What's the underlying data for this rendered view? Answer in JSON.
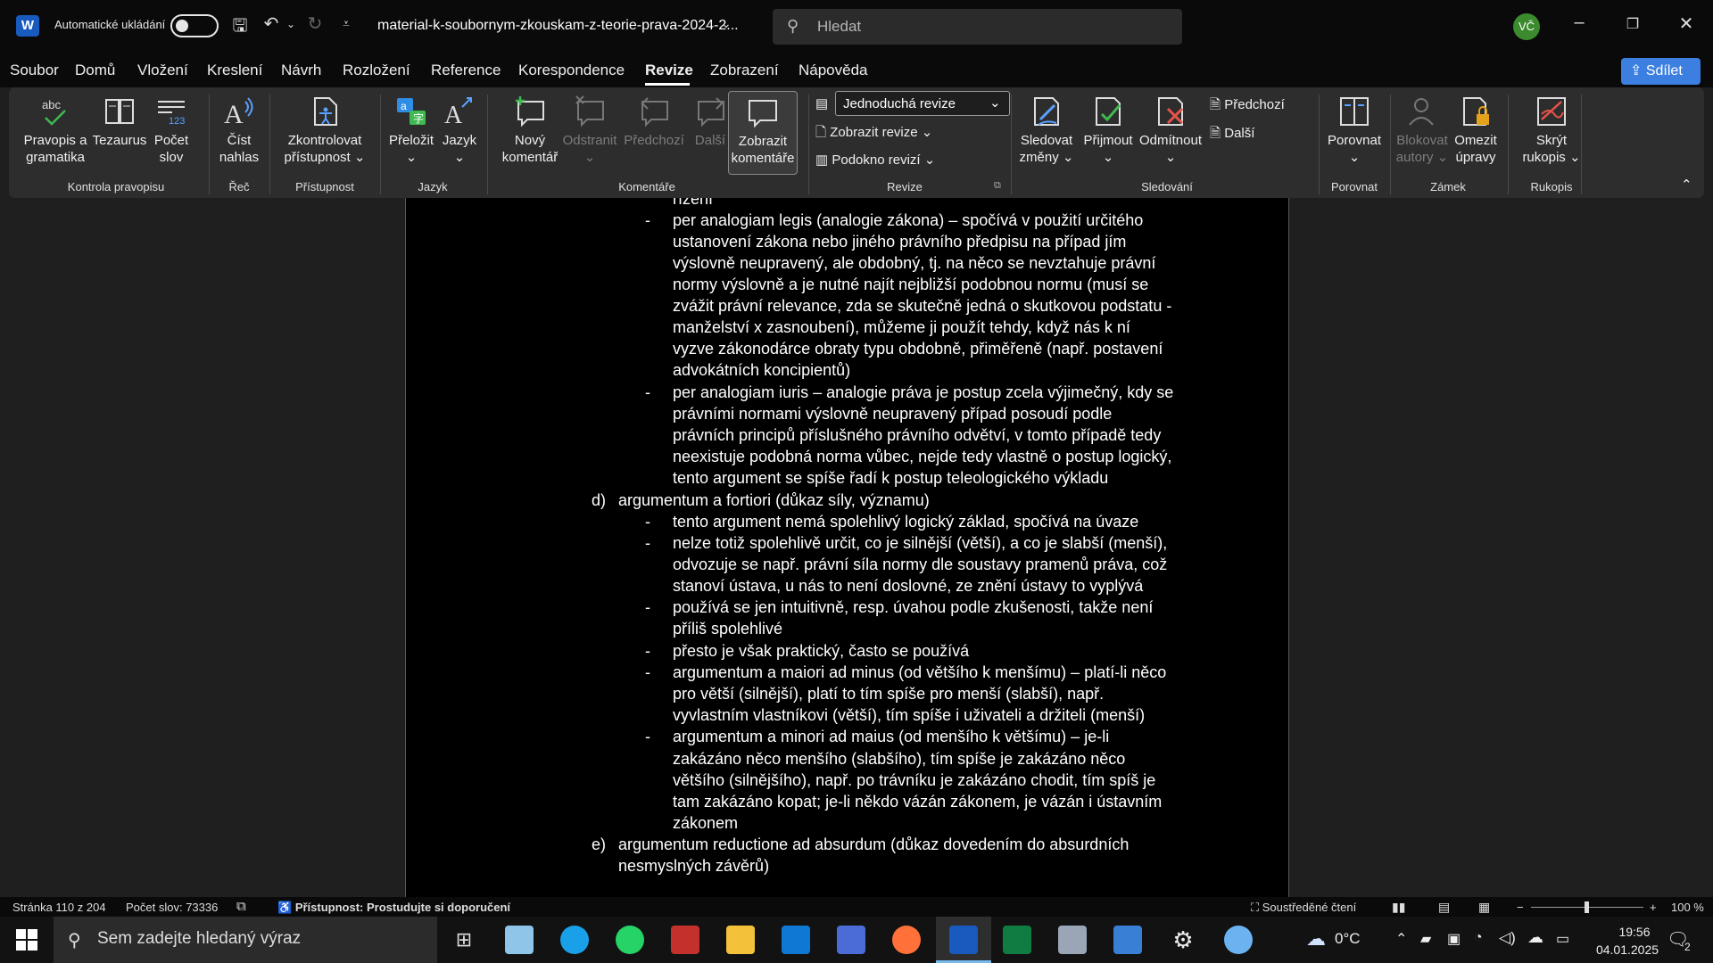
{
  "titlebar": {
    "app_letter": "W",
    "autosave_label": "Automatické ukládání",
    "doc_title": "material-k-soubornym-zkouskam-z-teorie-prava-2024-2...",
    "search_placeholder": "Hledat",
    "user_initials": "VČ"
  },
  "menu": {
    "items": [
      "Soubor",
      "Domů",
      "Vložení",
      "Kreslení",
      "Návrh",
      "Rozložení",
      "Reference",
      "Korespondence",
      "Revize",
      "Zobrazení",
      "Nápověda"
    ],
    "share": "Sdílet"
  },
  "ribbon": {
    "spelling": "Pravopis a",
    "spelling2": "gramatika",
    "thesaurus": "Tezaurus",
    "wordcount": "Počet",
    "wordcount2": "slov",
    "readaloud": "Číst",
    "readaloud2": "nahlas",
    "access": "Zkontrolovat",
    "access2": "přístupnost",
    "translate": "Přeložit",
    "language": "Jazyk",
    "newcomment": "Nový",
    "newcomment2": "komentář",
    "delete": "Odstranit",
    "prev": "Předchozí",
    "next": "Další",
    "showcomments": "Zobrazit",
    "showcomments2": "komentáře",
    "markup": "Jednoduchá revize",
    "showmarkup": "Zobrazit revize",
    "pane": "Podokno revizí",
    "track": "Sledovat",
    "track2": "změny",
    "accept": "Přijmout",
    "reject": "Odmítnout",
    "prevchange": "Předchozí",
    "nextchange": "Další",
    "compare": "Porovnat",
    "block": "Blokovat",
    "block2": "autory",
    "restrict": "Omezit",
    "restrict2": "úpravy",
    "hideink": "Skrýt",
    "hideink2": "rukopis",
    "groups": {
      "proofing": "Kontrola pravopisu",
      "speech": "Řeč",
      "accessibility": "Přístupnost",
      "language": "Jazyk",
      "comments": "Komentáře",
      "revize": "Revize",
      "tracking": "Sledování",
      "compare": "Porovnat",
      "protect": "Zámek",
      "ink": "Rukopis"
    }
  },
  "document": {
    "lines": [
      "řízení",
      "per analogiam legis (analogie zákona) – spočívá v použití určitého",
      "ustanovení zákona nebo jiného právního předpisu na případ jím",
      "výslovně neupravený, ale obdobný, tj. na něco se nevztahuje právní",
      "normy výslovně a je nutné najít nejbližší podobnou normu (musí se",
      "zvážit právní relevance, zda se skutečně jedná o skutkovou podstatu -",
      "manželství x zasnoubení), můžeme ji použít tehdy, když nás k ní",
      "vyzve zákonodárce obraty typu obdobně, přiměřeně (např. postavení",
      "advokátních koncipientů)",
      "per analogiam iuris – analogie práva je postup zcela výjimečný, kdy se",
      "právními normami výslovně neupravený případ posoudí podle",
      "právních principů příslušného právního odvětví, v tomto případě tedy",
      "neexistuje podobná norma vůbec, nejde tedy vlastně o postup logický,",
      "tento argument se spíše řadí k postup teleologického výkladu",
      "argumentum a fortiori (důkaz síly, významu)",
      "tento argument nemá spolehlivý logický základ, spočívá na úvaze",
      "nelze totiž spolehlivě určit, co je silnější (větší), a co je slabší (menší),",
      "odvozuje se např. právní síla normy dle soustavy pramenů práva, což",
      "stanoví ústava, u nás to není doslovné, ze znění ústavy to vyplývá",
      "používá se jen intuitivně, resp. úvahou podle zkušenosti, takže není",
      "příliš spolehlivé",
      "přesto je však praktický, často se používá",
      "argumentum a maiori ad minus (od většího k menšímu) – platí-li něco",
      "pro větší (silnější), platí to tím spíše pro menší (slabší), např.",
      "vyvlastním vlastníkovi (větší), tím spíše i uživateli a držiteli (menší)",
      "argumentum a minori ad maius (od menšího k většímu) – je-li",
      "zakázáno něco menšího (slabšího), tím spíše je zakázáno něco",
      "většího (silnějšího), např. po trávníku je zakázáno chodit, tím spíš je",
      "tam zakázáno kopat; je-li někdo vázán zákonem, je vázán i ústavním",
      "zákonem",
      "argumentum reductione ad absurdum (důkaz dovedením do absurdních",
      "nesmyslných závěrů)"
    ],
    "markers": {
      "d": "d)",
      "e": "e)",
      "dash": "-"
    }
  },
  "status": {
    "page": "Stránka 110 z 204",
    "words": "Počet slov: 73336",
    "accessibility": "Přístupnost: Prostudujte si doporučení",
    "focus": "Soustředěné čtení",
    "zoom": "100 %"
  },
  "taskbar": {
    "search_placeholder": "Sem zadejte hledaný výraz",
    "weather": "0°C",
    "time": "19:56",
    "date": "04.01.2025",
    "notifications": "2"
  }
}
